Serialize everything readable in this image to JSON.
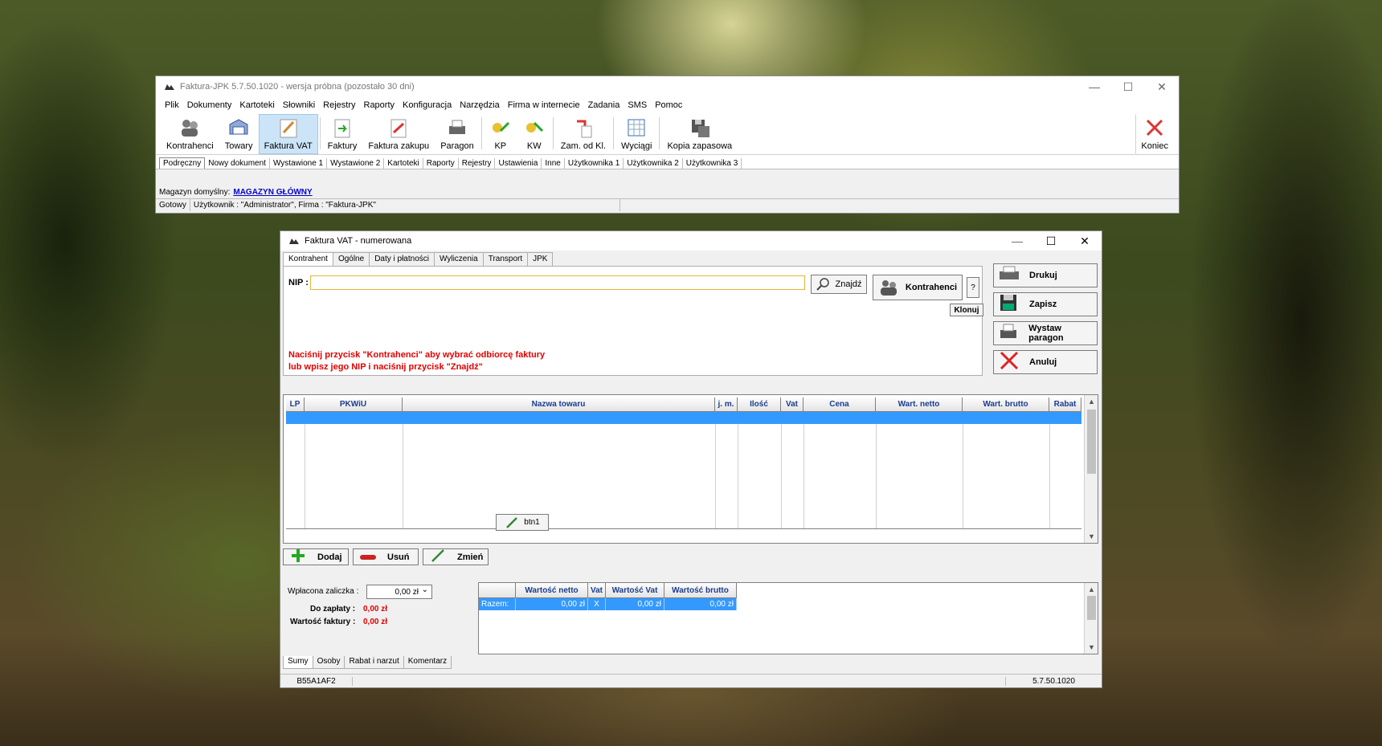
{
  "main_window": {
    "title": "Faktura-JPK 5.7.50.1020 - wersja próbna (pozostało 30 dni)",
    "controls": {
      "minimize": "—",
      "maximize": "☐",
      "close": "✕"
    },
    "menu": [
      "Plik",
      "Dokumenty",
      "Kartoteki",
      "Słowniki",
      "Rejestry",
      "Raporty",
      "Konfiguracja",
      "Narzędzia",
      "Firma w internecie",
      "Zadania",
      "SMS",
      "Pomoc"
    ],
    "toolbar": [
      {
        "label": "Kontrahenci",
        "icon": "contacts-icon"
      },
      {
        "label": "Towary",
        "icon": "goods-icon"
      },
      {
        "label": "Faktura VAT",
        "icon": "invoice-pen-icon"
      },
      {
        "label": "Faktury",
        "icon": "invoices-icon"
      },
      {
        "label": "Faktura zakupu",
        "icon": "purchase-invoice-icon"
      },
      {
        "label": "Paragon",
        "icon": "receipt-printer-icon"
      },
      {
        "label": "KP",
        "icon": "cash-in-icon"
      },
      {
        "label": "KW",
        "icon": "cash-out-icon"
      },
      {
        "label": "Zam. od Kl.",
        "icon": "order-icon"
      },
      {
        "label": "Wyciągi",
        "icon": "statements-icon"
      },
      {
        "label": "Kopia zapasowa",
        "icon": "backup-icon"
      }
    ],
    "exit_label": "Koniec",
    "tabs": [
      "Podręczny",
      "Nowy dokument",
      "Wystawione 1",
      "Wystawione 2",
      "Kartoteki",
      "Raporty",
      "Rejestry",
      "Ustawienia",
      "Inne",
      "Użytkownika 1",
      "Użytkownika 2",
      "Użytkownika 3"
    ],
    "magazyn_label": "Magazyn domyślny:",
    "magazyn_value": "MAGAZYN GŁÓWNY",
    "status_ready": "Gotowy",
    "status_user": "Użytkownik : \"Administrator\", Firma : \"Faktura-JPK\""
  },
  "dialog": {
    "title": "Faktura VAT - numerowana",
    "controls": {
      "minimize": "—",
      "maximize": "☐",
      "close": "✕"
    },
    "tabs": [
      "Kontrahent",
      "Ogólne",
      "Daty i płatności",
      "Wyliczenia",
      "Transport",
      "JPK"
    ],
    "nip_label": "NIP :",
    "nip_value": "",
    "find_label": "Znajdź",
    "contractors_label": "Kontrahenci",
    "help_label": "?",
    "clone_label": "Klonuj",
    "hint_line1": "Naciśnij przycisk \"Kontrahenci\" aby wybrać odbiorcę faktury",
    "hint_line2": "lub wpisz jego NIP i naciśnij przycisk \"Znajdź\"",
    "side_buttons": {
      "print": "Drukuj",
      "save": "Zapisz",
      "receipt": "Wystaw paragon",
      "cancel": "Anuluj"
    },
    "grid_columns": [
      "LP",
      "PKWiU",
      "Nazwa towaru",
      "j. m.",
      "Ilość",
      "Vat",
      "Cena",
      "Wart. netto",
      "Wart. brutto",
      "Rabat"
    ],
    "btn1_label": "btn1",
    "row_buttons": {
      "add": "Dodaj",
      "remove": "Usuń",
      "edit": "Zmień"
    },
    "advance_label": "Wpłacona zaliczka :",
    "advance_value": "0,00 zł",
    "to_pay_label": "Do zapłaty :",
    "to_pay_value": "0,00 zł",
    "invoice_value_label": "Wartość faktury :",
    "invoice_value": "0,00 zł",
    "summary_columns": [
      "",
      "Wartość netto",
      "Vat",
      "Wartość Vat",
      "Wartość brutto"
    ],
    "summary_row": {
      "label": "Razem:",
      "net": "0,00 zł",
      "vat": "X",
      "vat_value": "0,00 zł",
      "gross": "0,00 zł"
    },
    "bottom_tabs": [
      "Sumy",
      "Osoby",
      "Rabat i narzut",
      "Komentarz"
    ],
    "status_code": "B55A1AF2",
    "status_version": "5.7.50.1020"
  }
}
